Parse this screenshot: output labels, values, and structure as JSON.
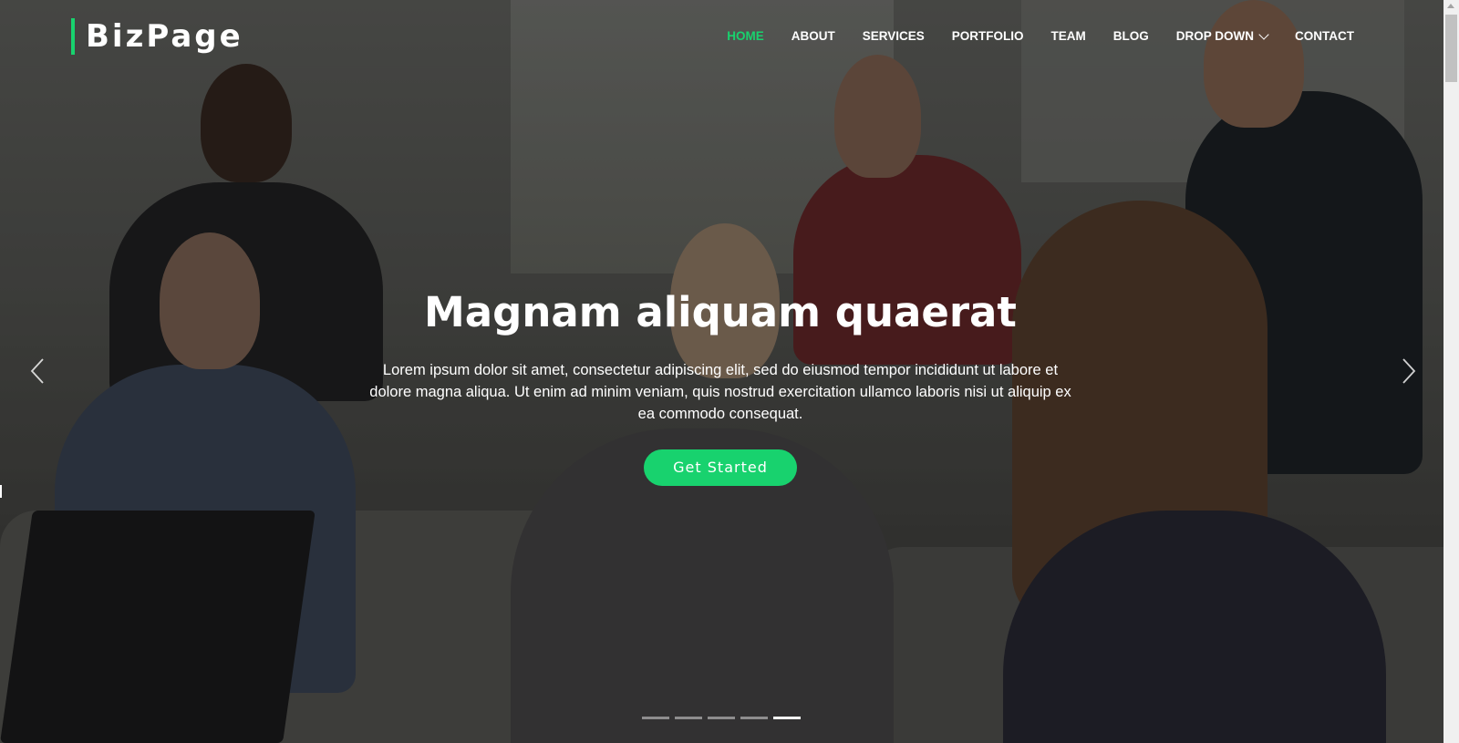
{
  "brand": {
    "logo_text": "BizPage",
    "accent_color": "#18d26e"
  },
  "nav": {
    "items": [
      {
        "label": "HOME",
        "active": true
      },
      {
        "label": "ABOUT",
        "active": false
      },
      {
        "label": "SERVICES",
        "active": false
      },
      {
        "label": "PORTFOLIO",
        "active": false
      },
      {
        "label": "TEAM",
        "active": false
      },
      {
        "label": "BLOG",
        "active": false
      },
      {
        "label": "DROP DOWN",
        "active": false,
        "icon": "chevron-down-icon"
      },
      {
        "label": "CONTACT",
        "active": false
      }
    ]
  },
  "hero": {
    "title": "Magnam aliquam quaerat",
    "text": "Lorem ipsum dolor sit amet, consectetur adipiscing elit, sed do eiusmod tempor incididunt ut labore et dolore magna aliqua. Ut enim ad minim veniam, quis nostrud exercitation ullamco laboris nisi ut aliquip ex ea commodo consequat.",
    "cta_label": "Get Started",
    "background": "team meeting photo"
  },
  "carousel": {
    "prev_icon": "chevron-left-icon",
    "next_icon": "chevron-right-icon",
    "slide_count": 5,
    "active_slide": 5
  }
}
